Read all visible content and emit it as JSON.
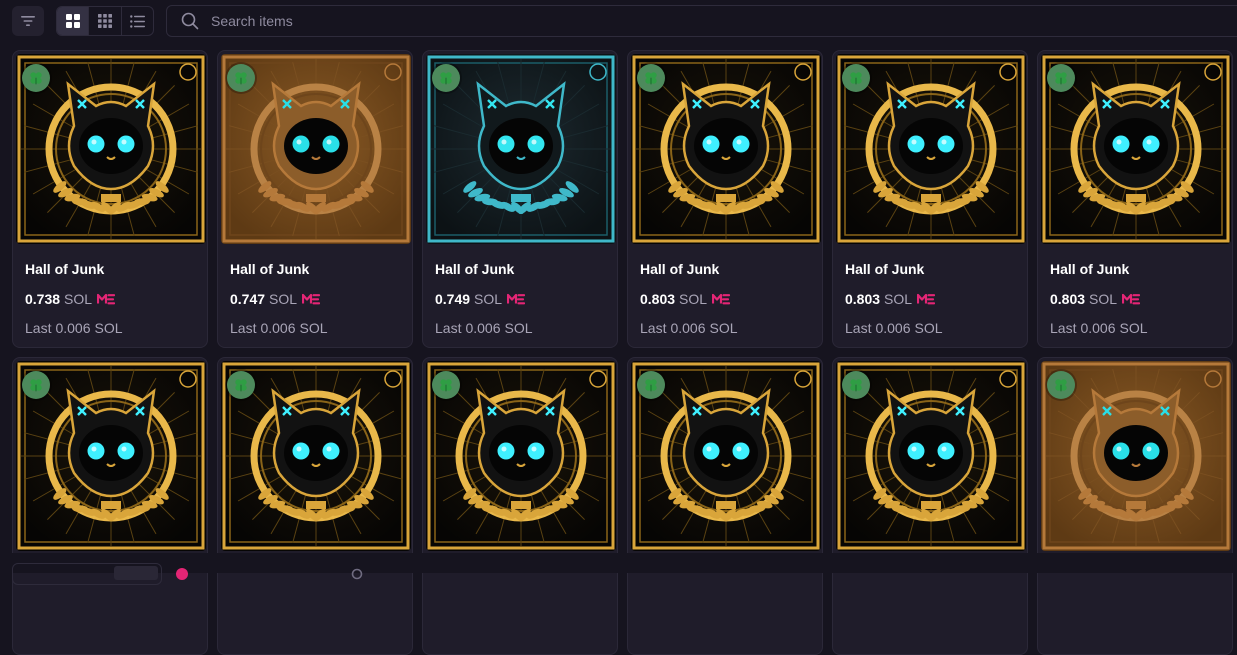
{
  "toolbar": {
    "search_placeholder": "Search items",
    "view_modes": [
      "large-grid",
      "small-grid",
      "list"
    ],
    "active_view": "large-grid"
  },
  "colors": {
    "background": "#16141f",
    "card": "#1f1c2a",
    "accent_me": "#e42575",
    "lucky_badge": "#4d8a5c"
  },
  "items": [
    {
      "name": "Hall of Junk",
      "price": "0.738",
      "unit": "SOL",
      "last_label": "Last",
      "last_price": "0.006",
      "last_unit": "SOL",
      "art": "gold"
    },
    {
      "name": "Hall of Junk",
      "price": "0.747",
      "unit": "SOL",
      "last_label": "Last",
      "last_price": "0.006",
      "last_unit": "SOL",
      "art": "bronze"
    },
    {
      "name": "Hall of Junk",
      "price": "0.749",
      "unit": "SOL",
      "last_label": "Last",
      "last_price": "0.006",
      "last_unit": "SOL",
      "art": "cyan"
    },
    {
      "name": "Hall of Junk",
      "price": "0.803",
      "unit": "SOL",
      "last_label": "Last",
      "last_price": "0.006",
      "last_unit": "SOL",
      "art": "gold"
    },
    {
      "name": "Hall of Junk",
      "price": "0.803",
      "unit": "SOL",
      "last_label": "Last",
      "last_price": "0.006",
      "last_unit": "SOL",
      "art": "gold"
    },
    {
      "name": "Hall of Junk",
      "price": "0.803",
      "unit": "SOL",
      "last_label": "Last",
      "last_price": "0.006",
      "last_unit": "SOL",
      "art": "gold"
    },
    {
      "name": "",
      "price": "",
      "unit": "",
      "last_label": "",
      "last_price": "",
      "last_unit": "",
      "art": "gold"
    },
    {
      "name": "",
      "price": "",
      "unit": "",
      "last_label": "",
      "last_price": "",
      "last_unit": "",
      "art": "gold"
    },
    {
      "name": "",
      "price": "",
      "unit": "",
      "last_label": "",
      "last_price": "",
      "last_unit": "",
      "art": "gold"
    },
    {
      "name": "",
      "price": "",
      "unit": "",
      "last_label": "",
      "last_price": "",
      "last_unit": "",
      "art": "gold"
    },
    {
      "name": "",
      "price": "",
      "unit": "",
      "last_label": "",
      "last_price": "",
      "last_unit": "",
      "art": "gold"
    },
    {
      "name": "",
      "price": "",
      "unit": "",
      "last_label": "",
      "last_price": "",
      "last_unit": "",
      "art": "bronze"
    }
  ],
  "icons": {
    "filter": "filter-icon",
    "search": "search-icon",
    "lucky": "clover-icon",
    "marketplace": "magic-eden-icon"
  }
}
